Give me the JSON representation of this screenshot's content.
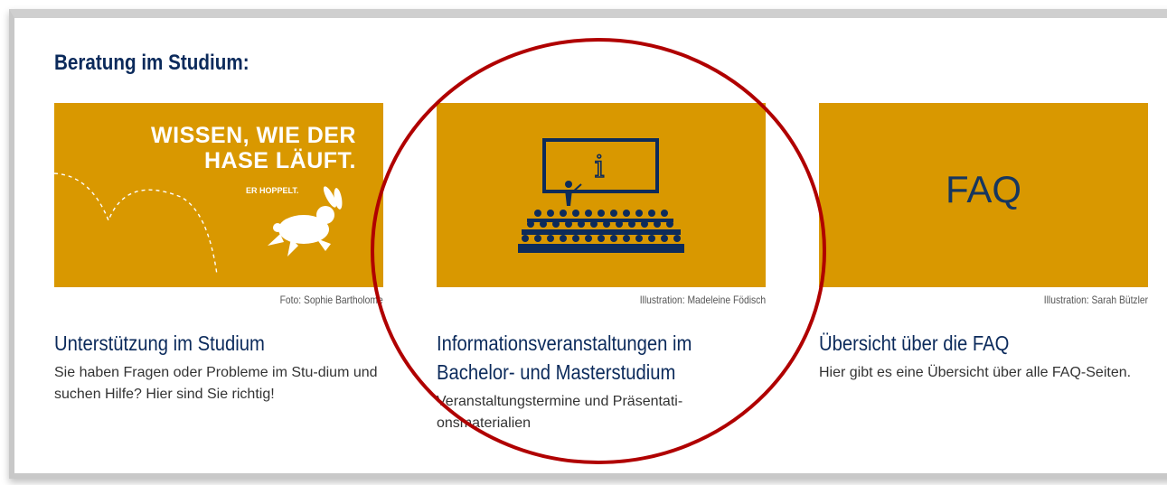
{
  "section": {
    "heading": "Beratung im Studium:"
  },
  "cards": [
    {
      "image_text_main_line1": "WISSEN, WIE DER",
      "image_text_main_line2": "HASE LÄUFT.",
      "image_text_sub": "ER HOPPELT.",
      "credit": "Foto: Sophie Bartholome",
      "title": "Unterstützung im Studium",
      "text": "Sie haben Fragen oder Probleme im Stu-dium und suchen Hilfe? Hier sind Sie richtig!",
      "icon": "rabbit-icon"
    },
    {
      "credit": "Illustration: Madeleine Födisch",
      "title": "Informationsveranstaltungen im Bachelor- und Masterstudium",
      "text": "Veranstaltungstermine und Präsentati-onsmaterialien",
      "icon": "lecture-hall-icon",
      "image_symbol": "i"
    },
    {
      "image_text": "FAQ",
      "credit": "Illustration: Sarah Bützler",
      "title": "Übersicht über die FAQ",
      "text": "Hier gibt es eine Übersicht über alle FAQ-Seiten.",
      "icon": "faq-image"
    }
  ],
  "colors": {
    "heading": "#0b2a5b",
    "image_bg": "#d99800",
    "annotation_circle": "#b00000"
  }
}
